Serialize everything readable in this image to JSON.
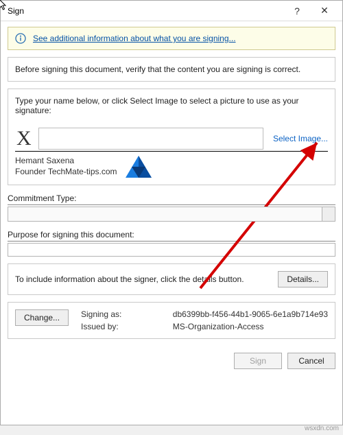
{
  "window": {
    "title": "Sign"
  },
  "infobar": {
    "link": "See additional information about what you are signing..."
  },
  "verify_msg": "Before signing this document, verify that the content you are signing is correct.",
  "signature": {
    "instruction": "Type your name below, or click Select Image to select a picture to use as your signature:",
    "x_mark": "X",
    "select_image": "Select Image...",
    "signer_name": "Hemant Saxena",
    "signer_title": "Founder TechMate-tips.com"
  },
  "commitment_label": "Commitment Type:",
  "purpose_label": "Purpose for signing this document:",
  "details": {
    "text": "To include information about the signer, click the details button.",
    "button": "Details..."
  },
  "identity": {
    "signing_as_label": "Signing as:",
    "signing_as_value": "db6399bb-f456-44b1-9065-6e1a9b714e93",
    "issued_by_label": "Issued by:",
    "issued_by_value": "MS-Organization-Access",
    "change_button": "Change..."
  },
  "footer": {
    "sign": "Sign",
    "cancel": "Cancel"
  },
  "watermark": "wsxdn.com"
}
